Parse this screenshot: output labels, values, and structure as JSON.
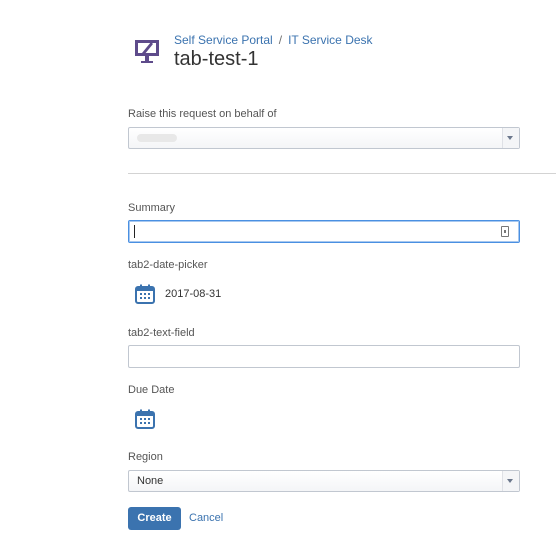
{
  "breadcrumb": {
    "portal": "Self Service Portal",
    "separator": "/",
    "desk": "IT Service Desk"
  },
  "page": {
    "title": "tab-test-1",
    "icon": "monitor-portal-icon"
  },
  "form": {
    "on_behalf": {
      "label": "Raise this request on behalf of",
      "value": ""
    },
    "summary": {
      "label": "Summary",
      "value": "",
      "icon": "field-helper-icon"
    },
    "date_picker": {
      "label": "tab2-date-picker",
      "value": "2017-08-31",
      "icon": "calendar-icon"
    },
    "text_field": {
      "label": "tab2-text-field",
      "value": ""
    },
    "due_date": {
      "label": "Due Date",
      "value": "",
      "icon": "calendar-icon"
    },
    "region": {
      "label": "Region",
      "value": "None"
    }
  },
  "actions": {
    "create": "Create",
    "cancel": "Cancel"
  },
  "colors": {
    "accent": "#3b73af",
    "focus": "#4a90e2",
    "icon_purple": "#6554c0"
  }
}
